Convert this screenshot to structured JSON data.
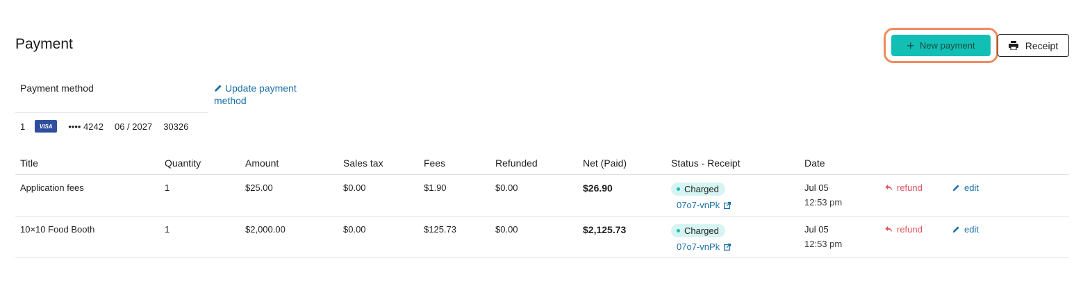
{
  "header": {
    "title": "Payment",
    "new_payment_label": "New payment",
    "receipt_label": "Receipt"
  },
  "payment_method": {
    "label": "Payment method",
    "update_label": "Update payment method",
    "index": "1",
    "brand": "VISA",
    "card_masked": "•••• 4242",
    "expiry": "06 / 2027",
    "zip": "30326"
  },
  "table": {
    "headers": {
      "title": "Title",
      "quantity": "Quantity",
      "amount": "Amount",
      "sales_tax": "Sales tax",
      "fees": "Fees",
      "refunded": "Refunded",
      "net": "Net (Paid)",
      "status": "Status - Receipt",
      "date": "Date"
    },
    "rows": [
      {
        "title": "Application fees",
        "quantity": "1",
        "amount": "$25.00",
        "sales_tax": "$0.00",
        "fees": "$1.90",
        "refunded": "$0.00",
        "net": "$26.90",
        "status": "Charged",
        "receipt_id": "07o7-vnPk",
        "date": "Jul 05",
        "time": "12:53 pm",
        "refund_label": "refund",
        "edit_label": "edit"
      },
      {
        "title": "10×10 Food Booth",
        "quantity": "1",
        "amount": "$2,000.00",
        "sales_tax": "$0.00",
        "fees": "$125.73",
        "refunded": "$0.00",
        "net": "$2,125.73",
        "status": "Charged",
        "receipt_id": "07o7-vnPk",
        "date": "Jul 05",
        "time": "12:53 pm",
        "refund_label": "refund",
        "edit_label": "edit"
      }
    ]
  },
  "colors": {
    "accent_teal": "#12bfb4",
    "highlight_orange": "#f08a5d",
    "link_blue": "#1a6fa8",
    "refund_red": "#e0525c",
    "badge_bg": "#d6f4f1"
  }
}
